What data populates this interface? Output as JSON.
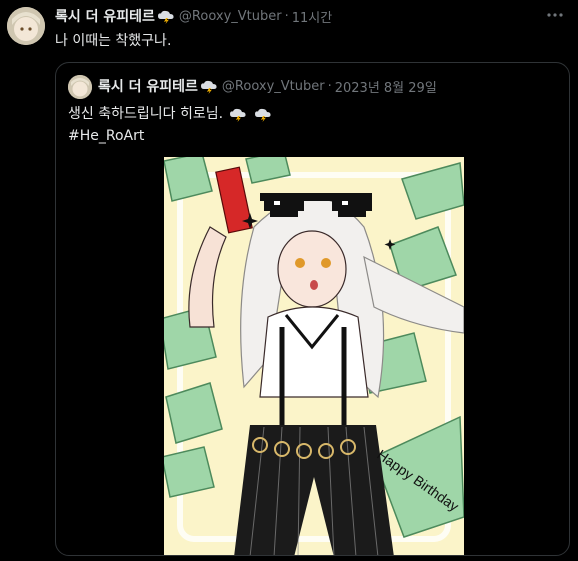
{
  "tweet": {
    "author_name": "록시 더 유피테르",
    "author_handle": "@Rooxy_Vtuber",
    "time": "11시간",
    "text": "나 이때는 착했구나.",
    "more_icon": "more-horizontal-icon"
  },
  "quote": {
    "author_name": "록시 더 유피테르",
    "author_handle": "@Rooxy_Vtuber",
    "date": "2023년 8월 29일",
    "text_line1": "생신 축하드립니다 히로님.",
    "hashtag": "#He_RoArt",
    "image_text": "Happy Birthday"
  },
  "colors": {
    "background": "#000000",
    "primary_text": "#e7e9ea",
    "secondary_text": "#71767b",
    "border": "#2f3336",
    "hashtag": "#e7e9ea",
    "money_green": "#9fd6a8",
    "art_background": "#fbf4c9"
  }
}
